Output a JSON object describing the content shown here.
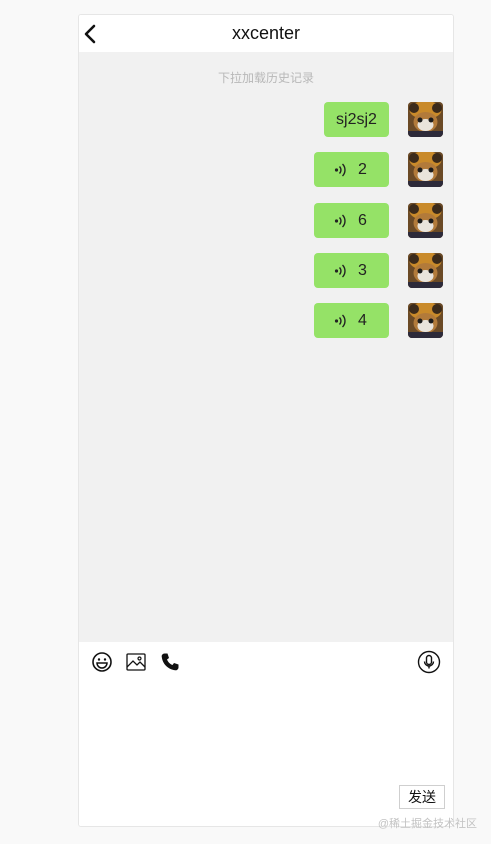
{
  "header": {
    "title": "xxcenter",
    "back_icon": "chevron-left-icon"
  },
  "chat": {
    "history_hint": "下拉加载历史记录",
    "messages": [
      {
        "type": "text",
        "content": "sj2sj2",
        "avatar": "avatar-icon"
      },
      {
        "type": "voice",
        "duration": "2",
        "icon": "voice-wave-icon",
        "avatar": "avatar-icon"
      },
      {
        "type": "voice",
        "duration": "6",
        "icon": "voice-wave-icon",
        "avatar": "avatar-icon"
      },
      {
        "type": "voice",
        "duration": "3",
        "icon": "voice-wave-icon",
        "avatar": "avatar-icon"
      },
      {
        "type": "voice",
        "duration": "4",
        "icon": "voice-wave-icon",
        "avatar": "avatar-icon"
      }
    ]
  },
  "toolbar": {
    "emoji_icon": "emoji-icon",
    "image_icon": "image-icon",
    "phone_icon": "phone-icon",
    "mic_icon": "microphone-icon"
  },
  "input": {
    "value": "",
    "send_label": "发送"
  },
  "watermark": "@稀土掘金技术社区",
  "colors": {
    "bubble": "#95e267",
    "chat_background": "#f1f1f1"
  }
}
